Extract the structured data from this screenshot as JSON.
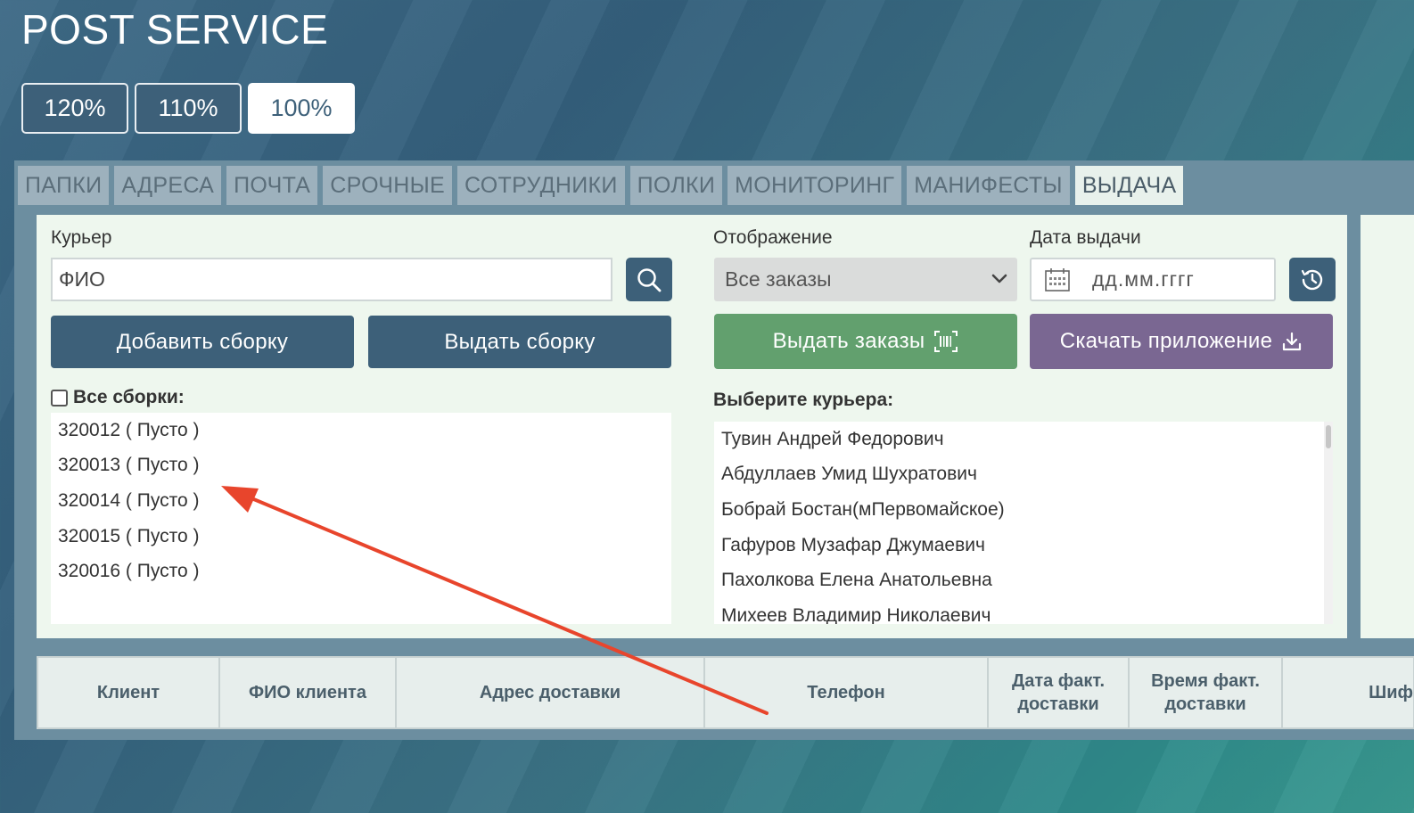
{
  "app": {
    "title": "POST SERVICE"
  },
  "zoom": {
    "options": [
      "120%",
      "110%",
      "100%"
    ],
    "selected": "100%"
  },
  "tabs": [
    "ПАПКИ",
    "АДРЕСА",
    "ПОЧТА",
    "СРОЧНЫЕ",
    "СОТРУДНИКИ",
    "ПОЛКИ",
    "МОНИТОРИНГ",
    "МАНИФЕСТЫ",
    "ВЫДАЧА"
  ],
  "active_tab": "ВЫДАЧА",
  "courier": {
    "label": "Курьер",
    "placeholder": "ФИО",
    "add_button": "Добавить сборку",
    "issue_button": "Выдать сборку",
    "all_label": "Все сборки:",
    "assemblies": [
      "320012 ( Пусто )",
      "320013 ( Пусто )",
      "320014 ( Пусто )",
      "320015 ( Пусто )",
      "320016 ( Пусто )"
    ]
  },
  "display": {
    "label": "Отображение",
    "selected": "Все заказы",
    "issue_orders_button": "Выдать заказы",
    "choose_label": "Выберите курьера:",
    "couriers": [
      "Тувин Андрей Федорович",
      "Абдуллаев Умид Шухратович",
      "Бобрай Бостан(мПервомайское)",
      "Гафуров Музафар Джумаевич",
      "Пахолкова Елена Анатольевна",
      "Михеев Владимир Николаевич"
    ]
  },
  "date": {
    "label": "Дата выдачи",
    "placeholder": "дд.мм.гггг",
    "download_button": "Скачать приложение"
  },
  "table": {
    "headers": [
      "Клиент",
      "ФИО клиента",
      "Адрес доставки",
      "Телефон",
      "Дата факт. доставки",
      "Время факт. доставки",
      "Шиф"
    ]
  },
  "colors": {
    "primary": "#3d6079",
    "green": "#62a06e",
    "purple": "#7a6792",
    "arrow": "#e8452c"
  }
}
